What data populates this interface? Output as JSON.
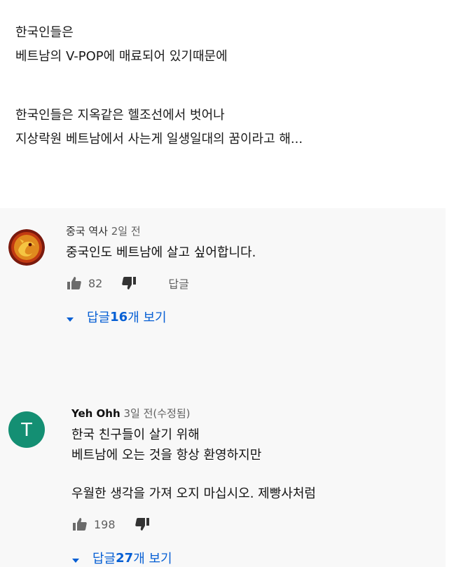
{
  "post": {
    "lines": [
      "한국인들은",
      "베트남의 V-POP에 매료되어 있기때문에",
      "한국인들은 지옥같은 헬조선에서 벗어나",
      "지상락원 베트남에서 사는게 일생일대의 꿈이라고 해..."
    ]
  },
  "comments": [
    {
      "author": "중국 역사",
      "time": "2일 전",
      "avatar_icon": "dragon-avatar-icon",
      "text_lines": [
        "중국인도 베트남에 살고 싶어합니다."
      ],
      "likes": "82",
      "reply_label": "답글",
      "replies_prefix": "답글 ",
      "replies_count": "16",
      "replies_suffix": "개 보기"
    },
    {
      "author": "Yeh Ohh",
      "time": "3일 전(수정됨)",
      "avatar_letter": "T",
      "avatar_color": "#148f73",
      "text_lines": [
        "한국 친구들이 살기 위해",
        "베트남에 오는 것을 항상 환영하지만",
        "우월한 생각을 가져 오지 마십시오. 제빵사처럼"
      ],
      "likes": "198",
      "replies_prefix": "답글 ",
      "replies_count": "27",
      "replies_suffix": "개 보기"
    }
  ],
  "colors": {
    "link": "#065fd4",
    "comment_bg": "#f8f8f8",
    "meta": "#606060"
  }
}
